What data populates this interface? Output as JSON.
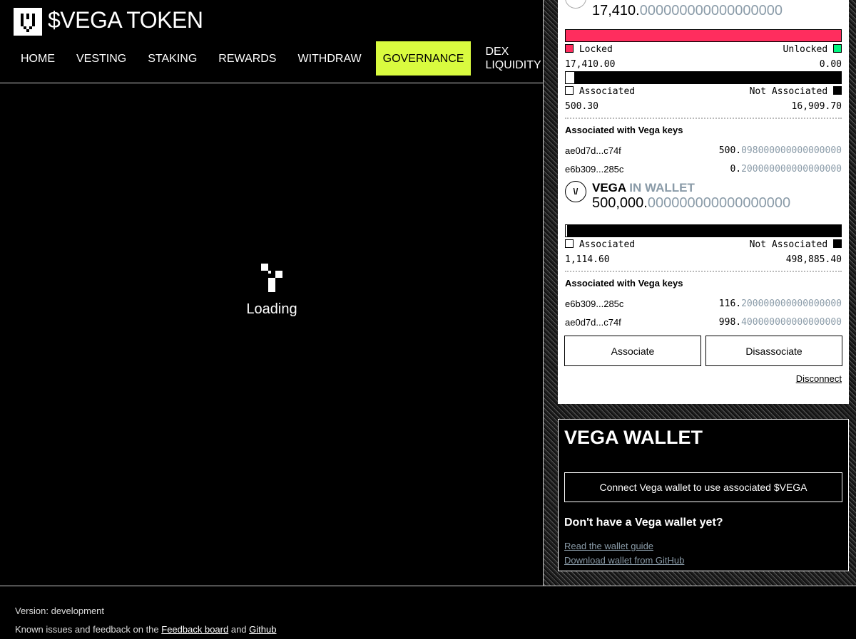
{
  "header": {
    "title": "$VEGA TOKEN",
    "nav": [
      "HOME",
      "VESTING",
      "STAKING",
      "REWARDS",
      "WITHDRAW",
      "GOVERNANCE",
      "DEX LIQUIDITY"
    ],
    "active": "GOVERNANCE"
  },
  "main": {
    "loading": "Loading"
  },
  "vesting": {
    "amount_int": "17,410.",
    "amount_dec": "000000000000000000",
    "locked_label": "Locked",
    "unlocked_label": "Unlocked",
    "locked": "17,410.00",
    "unlocked": "0.00",
    "locked_fraction": 1.0,
    "associated_label": "Associated",
    "not_associated_label": "Not Associated",
    "associated": "500.30",
    "not_associated": "16,909.70",
    "associated_fraction": 0.029,
    "keys_heading": "Associated with Vega keys",
    "keys": [
      {
        "key": "ae0d7d...c74f",
        "int": "500.",
        "dec": "098000000000000000"
      },
      {
        "key": "e6b309...285c",
        "int": "0.",
        "dec": "200000000000000000"
      }
    ]
  },
  "wallet_token": {
    "name": "VEGA",
    "suffix": "IN WALLET",
    "amount_int": "500,000.",
    "amount_dec": "000000000000000000",
    "associated_label": "Associated",
    "not_associated_label": "Not Associated",
    "associated": "1,114.60",
    "not_associated": "498,885.40",
    "associated_fraction": 0.002,
    "keys_heading": "Associated with Vega keys",
    "keys": [
      {
        "key": "e6b309...285c",
        "int": "116.",
        "dec": "200000000000000000"
      },
      {
        "key": "ae0d7d...c74f",
        "int": "998.",
        "dec": "400000000000000000"
      }
    ],
    "associate": "Associate",
    "disassociate": "Disassociate",
    "disconnect": "Disconnect"
  },
  "vega_wallet": {
    "title": "VEGA WALLET",
    "connect": "Connect Vega wallet to use associated $VEGA",
    "no_wallet": "Don't have a Vega wallet yet?",
    "guide": "Read the wallet guide",
    "download": "Download wallet from GitHub"
  },
  "footer": {
    "version": "Version: development",
    "issues_prefix": "Known issues and feedback on the",
    "feedback": "Feedback board",
    "and": "and",
    "github": "Github"
  },
  "colors": {
    "accent": "#d9fb3f",
    "locked": "#ff2d5e",
    "unlocked": "#00f780",
    "muted": "#8a9ba8"
  }
}
